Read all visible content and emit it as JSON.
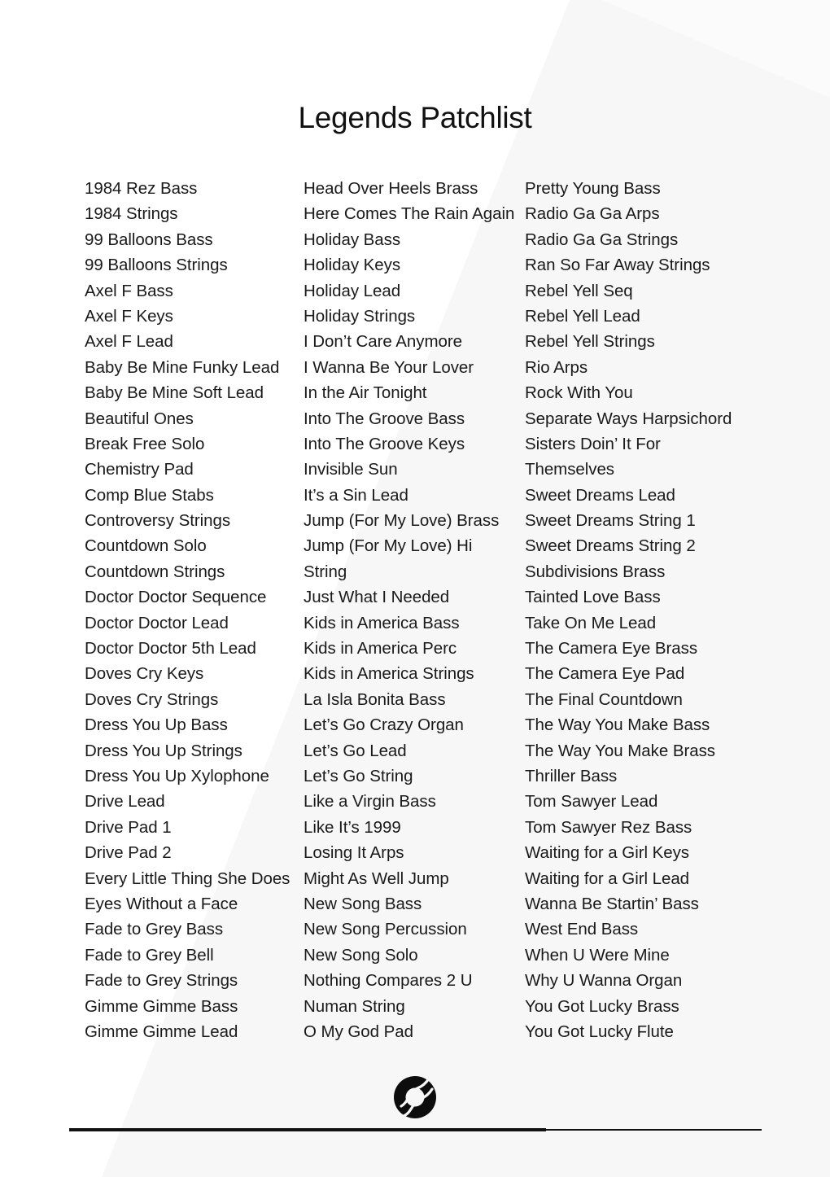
{
  "document": {
    "title": "Legends Patchlist",
    "background_color": "#ffffff",
    "text_color": "#1a1a1a",
    "watermark_color": "#f7f7f7"
  },
  "columns": [
    {
      "id": "column-1",
      "items": [
        "1984 Rez Bass",
        "1984 Strings",
        "99 Balloons Bass",
        "99 Balloons Strings",
        "Axel F Bass",
        "Axel F Keys",
        "Axel F Lead",
        "Baby Be Mine Funky Lead",
        "Baby Be Mine Soft Lead",
        "Beautiful Ones",
        "Break Free Solo",
        "Chemistry Pad",
        "Comp Blue Stabs",
        "Controversy Strings",
        "Countdown Solo",
        "Countdown Strings",
        "Doctor Doctor Sequence",
        "Doctor Doctor Lead",
        "Doctor Doctor 5th Lead",
        "Doves Cry Keys",
        "Doves Cry Strings",
        "Dress You Up Bass",
        "Dress You Up Strings",
        "Dress You Up Xylophone",
        "Drive Lead",
        "Drive Pad 1",
        "Drive Pad 2",
        "Every Little Thing She Does",
        "Eyes Without a Face",
        "Fade to Grey Bass",
        "Fade to Grey Bell",
        "Fade to Grey Strings",
        "Gimme Gimme Bass",
        "Gimme Gimme Lead"
      ]
    },
    {
      "id": "column-2",
      "items": [
        "Head Over Heels Brass",
        "Here Comes The Rain Again",
        "Holiday Bass",
        "Holiday Keys",
        "Holiday Lead",
        "Holiday Strings",
        "I Don’t Care Anymore",
        "I Wanna Be Your Lover",
        "In the Air Tonight",
        "Into The Groove Bass",
        "Into The Groove Keys",
        "Invisible Sun",
        "It’s a Sin Lead",
        "Jump (For My Love) Brass",
        "Jump (For My Love) Hi",
        "String",
        "Just What I Needed",
        "Kids in America Bass",
        "Kids in America Perc",
        "Kids in America Strings",
        "La Isla Bonita Bass",
        "Let’s Go Crazy Organ",
        "Let’s Go Lead",
        "Let’s Go String",
        "Like a Virgin Bass",
        "Like It’s 1999",
        "Losing It Arps",
        "Might As Well Jump",
        "New Song Bass",
        "New Song Percussion",
        "New Song Solo",
        "Nothing Compares 2 U",
        "Numan String",
        "O My God Pad"
      ]
    },
    {
      "id": "column-3",
      "items": [
        "Pretty Young Bass",
        "Radio Ga Ga Arps",
        "Radio Ga Ga Strings",
        "Ran So Far Away Strings",
        "Rebel Yell Seq",
        "Rebel Yell Lead",
        "Rebel Yell Strings",
        "Rio Arps",
        "Rock With You",
        "Separate Ways Harpsichord",
        "Sisters Doin’ It For",
        "Themselves",
        "Sweet Dreams Lead",
        "Sweet Dreams String 1",
        "Sweet Dreams String 2",
        "Subdivisions Brass",
        "Tainted Love Bass",
        "Take On Me Lead",
        "The Camera Eye Brass",
        "The Camera Eye Pad",
        "The Final Countdown",
        "The Way You Make Bass",
        "The Way You Make Brass",
        "Thriller Bass",
        "Tom Sawyer Lead",
        "Tom Sawyer Rez Bass",
        "Waiting for a Girl Keys",
        "Waiting for a Girl Lead",
        "Wanna Be Startin’ Bass",
        "West End Bass",
        "When U Were Mine",
        "Why U Wanna Organ",
        "You Got Lucky Brass",
        "You Got Lucky Flute"
      ]
    }
  ],
  "footer": {
    "logo_icon": "ring-logo-icon",
    "logo_color": "#0d0d0d",
    "rule_color": "#111111"
  }
}
